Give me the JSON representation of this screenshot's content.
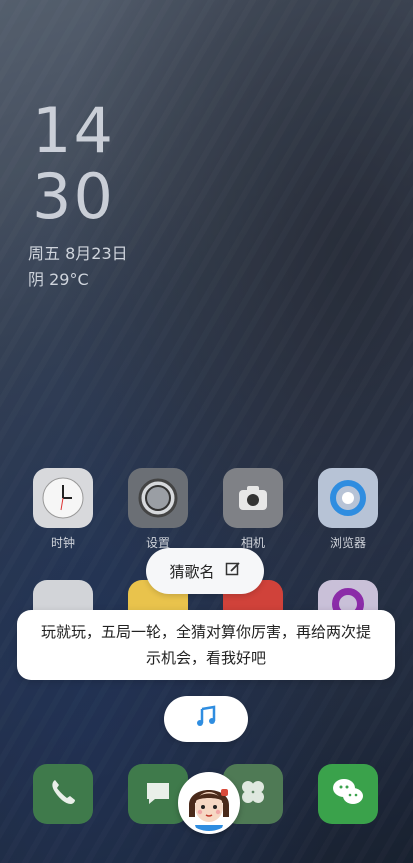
{
  "lockscreen": {
    "hour": "14",
    "minute": "30",
    "date": "周五  8月23日",
    "weather": "阴 29°C"
  },
  "apps_row1": [
    {
      "label": "时钟",
      "icon": "clock-icon"
    },
    {
      "label": "设置",
      "icon": "settings-gear-icon"
    },
    {
      "label": "相机",
      "icon": "camera-icon"
    },
    {
      "label": "浏览器",
      "icon": "browser-icon"
    }
  ],
  "overlay": {
    "guess_button_label": "猜歌名",
    "message": "玩就玩，五局一轮，全猜对算你厉害，再给两次提示机会，看我好吧",
    "music_icon": "music-note-icon"
  },
  "dock": [
    {
      "icon": "phone-icon"
    },
    {
      "icon": "messages-icon"
    },
    {
      "icon": "app-store-icon"
    },
    {
      "icon": "wechat-icon"
    }
  ],
  "colors": {
    "accent_blue": "#2f8de0",
    "green": "#3aa24b"
  }
}
